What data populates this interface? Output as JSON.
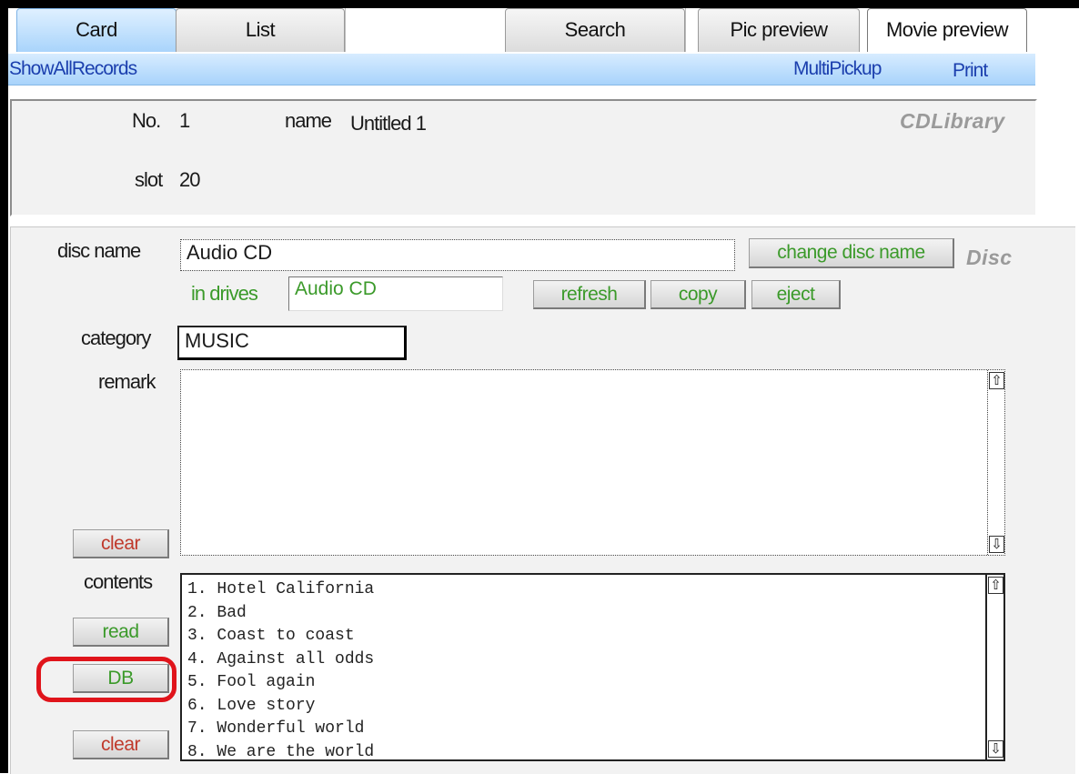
{
  "tabs": [
    "Card",
    "List",
    "Search",
    "Pic preview",
    "Movie preview"
  ],
  "actions": {
    "show_all": "ShowAllRecords",
    "multi_pickup": "MultiPickup",
    "print": "Print"
  },
  "record": {
    "no_label": "No.",
    "no_value": "1",
    "name_label": "name",
    "name_value": "Untitled 1",
    "slot_label": "slot",
    "slot_value": "20",
    "app_name": "CDLibrary"
  },
  "disc": {
    "section_label": "Disc",
    "disc_name_label": "disc name",
    "disc_name_value": "Audio CD",
    "change_button": "change disc name",
    "in_drives_label": "in drives",
    "in_drives_value": "Audio CD",
    "refresh_button": "refresh",
    "copy_button": "copy",
    "eject_button": "eject",
    "category_label": "category",
    "category_value": "MUSIC",
    "remark_label": "remark",
    "remark_value": "",
    "remark_clear": "clear",
    "contents_label": "contents",
    "read_button": "read",
    "db_button": "DB",
    "contents_clear": "clear",
    "tracks": [
      "1. Hotel California",
      "2. Bad",
      "3. Coast to coast",
      "4. Against all odds",
      "5. Fool again",
      "6. Love story",
      "7. Wonderful world",
      "8. We are the world"
    ]
  },
  "colors": {
    "tab_active": "#a9d4fb",
    "action_text": "#1b3fae",
    "green_text": "#3b9a2a",
    "red_text": "#c0392b",
    "highlight": "#e0141b"
  },
  "icons": {
    "scroll_up": "up-arrow-icon",
    "scroll_down": "down-arrow-icon"
  }
}
